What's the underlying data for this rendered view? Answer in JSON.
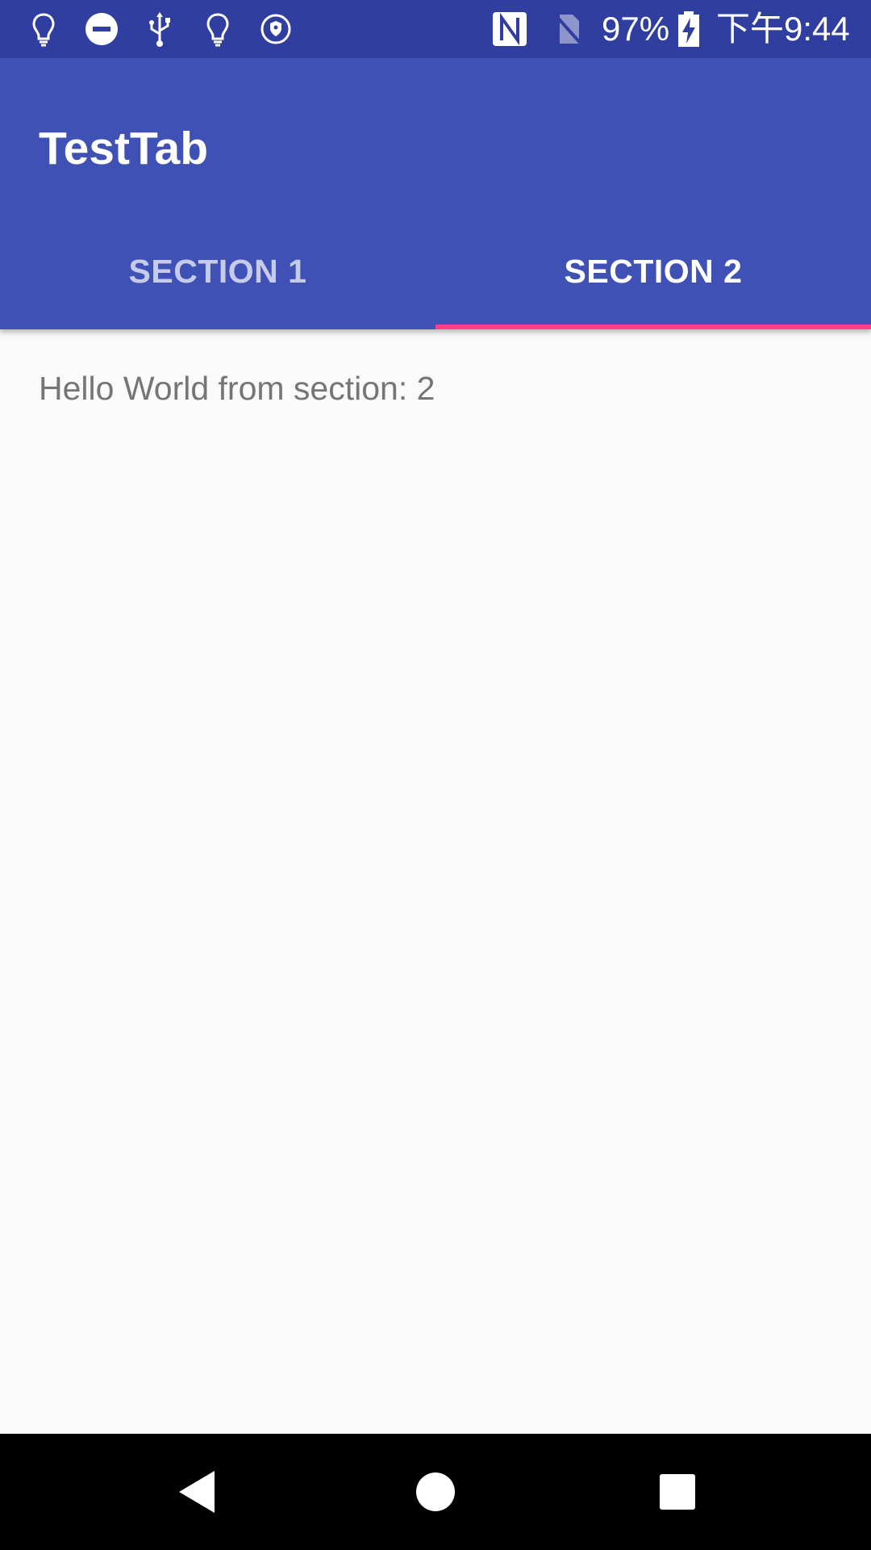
{
  "status_bar": {
    "left_icons": [
      "lightbulb-icon",
      "do-not-disturb-icon",
      "usb-icon",
      "lightbulb-outline-icon",
      "vpn-shield-icon"
    ],
    "right_icons": [
      "nfc-icon",
      "no-sim-icon",
      "battery-charging-icon"
    ],
    "battery_percent": "97%",
    "time": "下午9:44",
    "background": "#303f9f"
  },
  "app_bar": {
    "title": "TestTab",
    "background": "#3f51b5"
  },
  "tabs": [
    {
      "label": "SECTION 1",
      "selected": false
    },
    {
      "label": "SECTION 2",
      "selected": true
    }
  ],
  "tab_indicator_color": "#ff4081",
  "content": {
    "text": "Hello World from section: 2"
  },
  "nav_bar": {
    "buttons": [
      "back-icon",
      "home-icon",
      "recents-icon"
    ]
  }
}
